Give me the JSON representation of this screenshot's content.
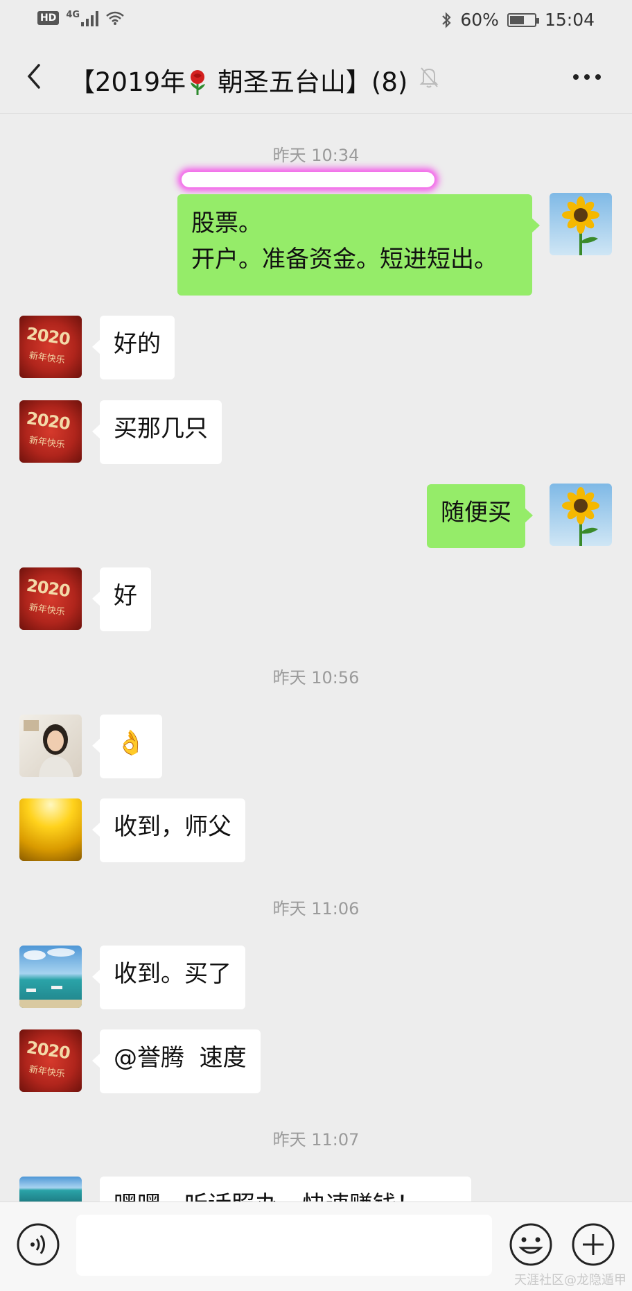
{
  "status_bar": {
    "hd": "HD",
    "network": "4G",
    "battery": "60%",
    "battery_level": 0.6,
    "time": "15:04"
  },
  "header": {
    "title_part1": "【2019年",
    "title_part2": "朝圣五台山】(8)"
  },
  "messages": {
    "t1": "昨天 10:34",
    "m1_line1": "股票。",
    "m1_line2": "开户。准备资金。短进短出。",
    "m2": "好的",
    "m3": "买那几只",
    "m4": "随便买",
    "m5": "好",
    "t2": "昨天 10:56",
    "m6": "👌",
    "m7": "收到，师父",
    "t3": "昨天 11:06",
    "m8": "收到。买了",
    "m9": "@誉腾  速度",
    "t4": "昨天 11:07",
    "m10": "嘿嘿，听话照办，快速赚钱！"
  },
  "avatars": {
    "red_card_text": "2020",
    "red_card_sub": "新年快乐"
  },
  "watermark": "天涯社区@龙隐遁甲"
}
